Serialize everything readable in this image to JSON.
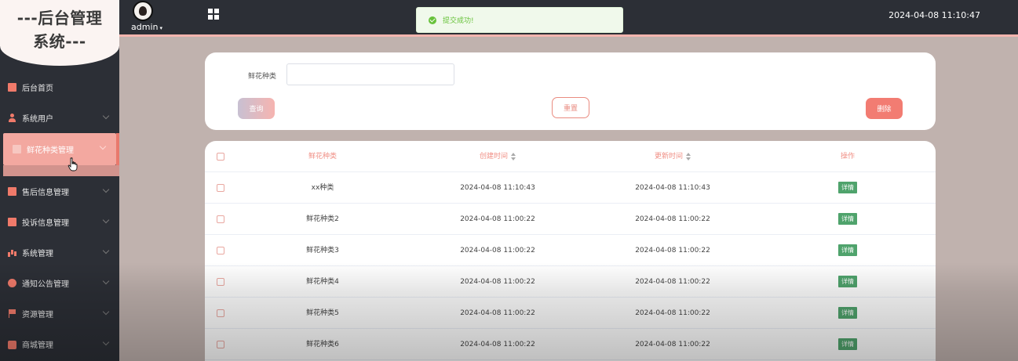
{
  "sidebar": {
    "logo_line1": "---后台管理",
    "logo_line2": "系统---",
    "items": [
      {
        "label": "后台首页",
        "icon": "screen-icon"
      },
      {
        "label": "系统用户",
        "icon": "user-icon"
      },
      {
        "label": "鲜花种类管理",
        "icon": "chart-icon"
      },
      {
        "label": "售后信息管理",
        "icon": "chart-icon"
      },
      {
        "label": "投诉信息管理",
        "icon": "chart-icon"
      },
      {
        "label": "系统管理",
        "icon": "bar-chart-icon"
      },
      {
        "label": "通知公告管理",
        "icon": "info-icon"
      },
      {
        "label": "资源管理",
        "icon": "flag-icon"
      },
      {
        "label": "商城管理",
        "icon": "shop-icon"
      }
    ]
  },
  "header": {
    "user": "admin",
    "datetime": "2024-04-08 11:10:47"
  },
  "toast": {
    "message": "提交成功!",
    "color": "#67c23a"
  },
  "search": {
    "label": "鲜花种类",
    "value": "",
    "query_label": "查询",
    "reset_label": "重置",
    "delete_label": "删除"
  },
  "table": {
    "columns": [
      "鲜花种类",
      "创建时间",
      "更新时间",
      "操作"
    ],
    "rows": [
      {
        "name": "xx种类",
        "created": "2024-04-08 11:10:43",
        "updated": "2024-04-08 11:10:43",
        "action": "详情"
      },
      {
        "name": "鲜花种类2",
        "created": "2024-04-08 11:00:22",
        "updated": "2024-04-08 11:00:22",
        "action": "详情"
      },
      {
        "name": "鲜花种类3",
        "created": "2024-04-08 11:00:22",
        "updated": "2024-04-08 11:00:22",
        "action": "详情"
      },
      {
        "name": "鲜花种类4",
        "created": "2024-04-08 11:00:22",
        "updated": "2024-04-08 11:00:22",
        "action": "详情"
      },
      {
        "name": "鲜花种类5",
        "created": "2024-04-08 11:00:22",
        "updated": "2024-04-08 11:00:22",
        "action": "详情"
      },
      {
        "name": "鲜花种类6",
        "created": "2024-04-08 11:00:22",
        "updated": "2024-04-08 11:00:22",
        "action": "详情"
      }
    ]
  },
  "colors": {
    "accent": "#f3a8a0",
    "sidebar_bg": "#2c2f36",
    "content_bg": "#c0b2ae",
    "detail_tag": "#4fa36c",
    "delete_button": "#f27c72"
  }
}
